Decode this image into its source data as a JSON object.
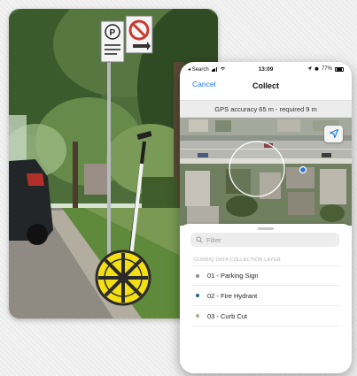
{
  "colors": {
    "accent": "#1a7ce8",
    "sign_red": "#c93a2e",
    "wheel_yellow": "#f3df12",
    "gps_dot": "#2d78c8"
  },
  "photo": {
    "parking_sign_letter": "P"
  },
  "status_bar": {
    "carrier": "◂ Search",
    "time": "13:09",
    "battery_percent": "77%"
  },
  "nav": {
    "cancel_label": "Cancel",
    "title": "Collect"
  },
  "gps": {
    "banner_text": "GPS accuracy 65 m - required 9 m"
  },
  "map": {
    "locate_icon": "location-arrow-icon"
  },
  "sheet": {
    "filter_placeholder": "Filter",
    "layer_header": "CURBIQ DATA COLLECTION LAYER",
    "items": [
      {
        "label": "01 - Parking Sign",
        "dot_color": "#8f8f8f"
      },
      {
        "label": "02 - Fire Hydrant",
        "dot_color": "#2b5d94"
      },
      {
        "label": "03 - Curb Cut",
        "dot_color": "#b4ae86"
      }
    ]
  }
}
